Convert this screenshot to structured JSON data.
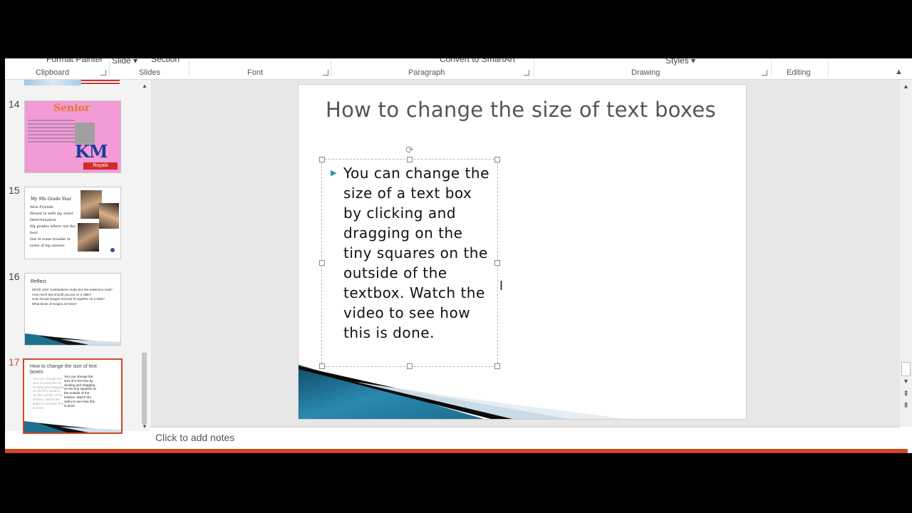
{
  "ribbon": {
    "cut_labels": {
      "format_painter": "Format Painter",
      "slide": "Slide ▾",
      "section": "Section",
      "convert": "Convert to SmartArt",
      "styles": "Styles ▾"
    },
    "groups": {
      "clipboard": "Clipboard",
      "slides": "Slides",
      "font": "Font",
      "paragraph": "Paragraph",
      "drawing": "Drawing",
      "editing": "Editing"
    },
    "collapse_glyph": "▲"
  },
  "thumbnails": [
    {
      "number": "14",
      "title": "Senior",
      "logo": "KM",
      "sub": "Royals"
    },
    {
      "number": "15",
      "title": "My 9th Grade Year",
      "items": [
        "New Friends",
        "Moved in with my sister",
        "Determination",
        "My grades where not the best",
        "Got in some trouble in some of my classes"
      ]
    },
    {
      "number": "16",
      "title": "Reflect",
      "items": [
        "Which color combinations make text the easiest to read?",
        "How much text should you put on a slide?",
        "How should images and text fit together on a slide?",
        "What kinds of images are best?"
      ]
    },
    {
      "number": "17",
      "title": "How to change the size of text boxes",
      "body": "You can change the size of a text box by clicking and dragging on the tiny squares on the outside of the textbox. Watch the video to see how this is done."
    }
  ],
  "slide": {
    "title": "How to change the size of text boxes",
    "body": "You can change the size of a text box by clicking and dragging on the tiny squares on the outside of the textbox. Watch the video to see how this is done.",
    "bullet_glyph": "▶",
    "cursor_glyph": "I",
    "rotate_glyph": "⟳"
  },
  "notes": {
    "placeholder": "Click to add notes"
  },
  "scroll_glyphs": {
    "up": "▲",
    "down": "▼",
    "prev_slide": "⇞",
    "next_slide": "⇟"
  },
  "colors": {
    "accent": "#d24726",
    "bullet": "#2e8fb4",
    "band": "#1e6e8e"
  }
}
